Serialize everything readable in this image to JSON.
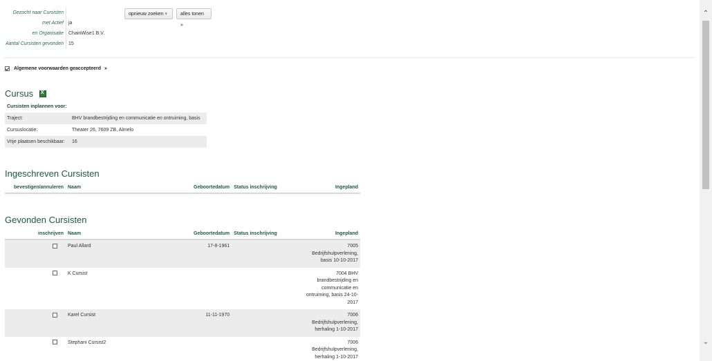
{
  "summary": [
    {
      "label": "Gezocht naar Cursisten",
      "value": ""
    },
    {
      "label": "met Actief",
      "value": "ja"
    },
    {
      "label": "en Organisatie",
      "value": "ChainWise1 B.V."
    },
    {
      "label": "Aantal Cursisten gevonden",
      "value": "15"
    }
  ],
  "buttons": {
    "search_again": "opnieuw zoeken",
    "show_all": "alles tonen »"
  },
  "terms": {
    "label": "Algemene voorwaarden geaccepteerd",
    "suffix": "»"
  },
  "course": {
    "title": "Cursus",
    "subtitle": "Cursisten inplannen voor:",
    "rows": [
      {
        "label": "Traject:",
        "value": "BHV brandbestrijding en communicatie en ontruiming, basis"
      },
      {
        "label": "Cursuslocatie:",
        "value": "Theater 26, 7609 ZB, Almelo"
      },
      {
        "label": "Vrije plaatsen beschikbaar:",
        "value": "16"
      }
    ]
  },
  "enrolled": {
    "title": "Ingeschreven Cursisten",
    "headers": {
      "action": "bevestigen/annuleren",
      "name": "Naam",
      "dob": "Geboortedatum",
      "status": "Status inschrijving",
      "planned": "Ingepland"
    }
  },
  "found": {
    "title": "Gevonden Cursisten",
    "headers": {
      "action": "inschrijven",
      "name": "Naam",
      "dob": "Geboortedatum",
      "status": "Status inschrijving",
      "planned": "Ingepland"
    },
    "rows": [
      {
        "name": "Paul Allard",
        "dob": "17-8-1961",
        "status": "",
        "planned": "7005 Bedrijfshulpverlening, basis 10-10-2017"
      },
      {
        "name": "K Cursist",
        "dob": "",
        "status": "",
        "planned": "7004 BHV brandbestrijding en communicatie en ontruiming, basis 24-10-2017"
      },
      {
        "name": "Karel Cursist",
        "dob": "11-11-1970",
        "status": "",
        "planned": "7006 Bedrijfshulpverlening, herhaling 1-10-2017"
      },
      {
        "name": "Stephani Cursist2",
        "dob": "",
        "status": "",
        "planned": "7006 Bedrijfshulpverlening, herhaling 1-10-2017"
      }
    ]
  }
}
